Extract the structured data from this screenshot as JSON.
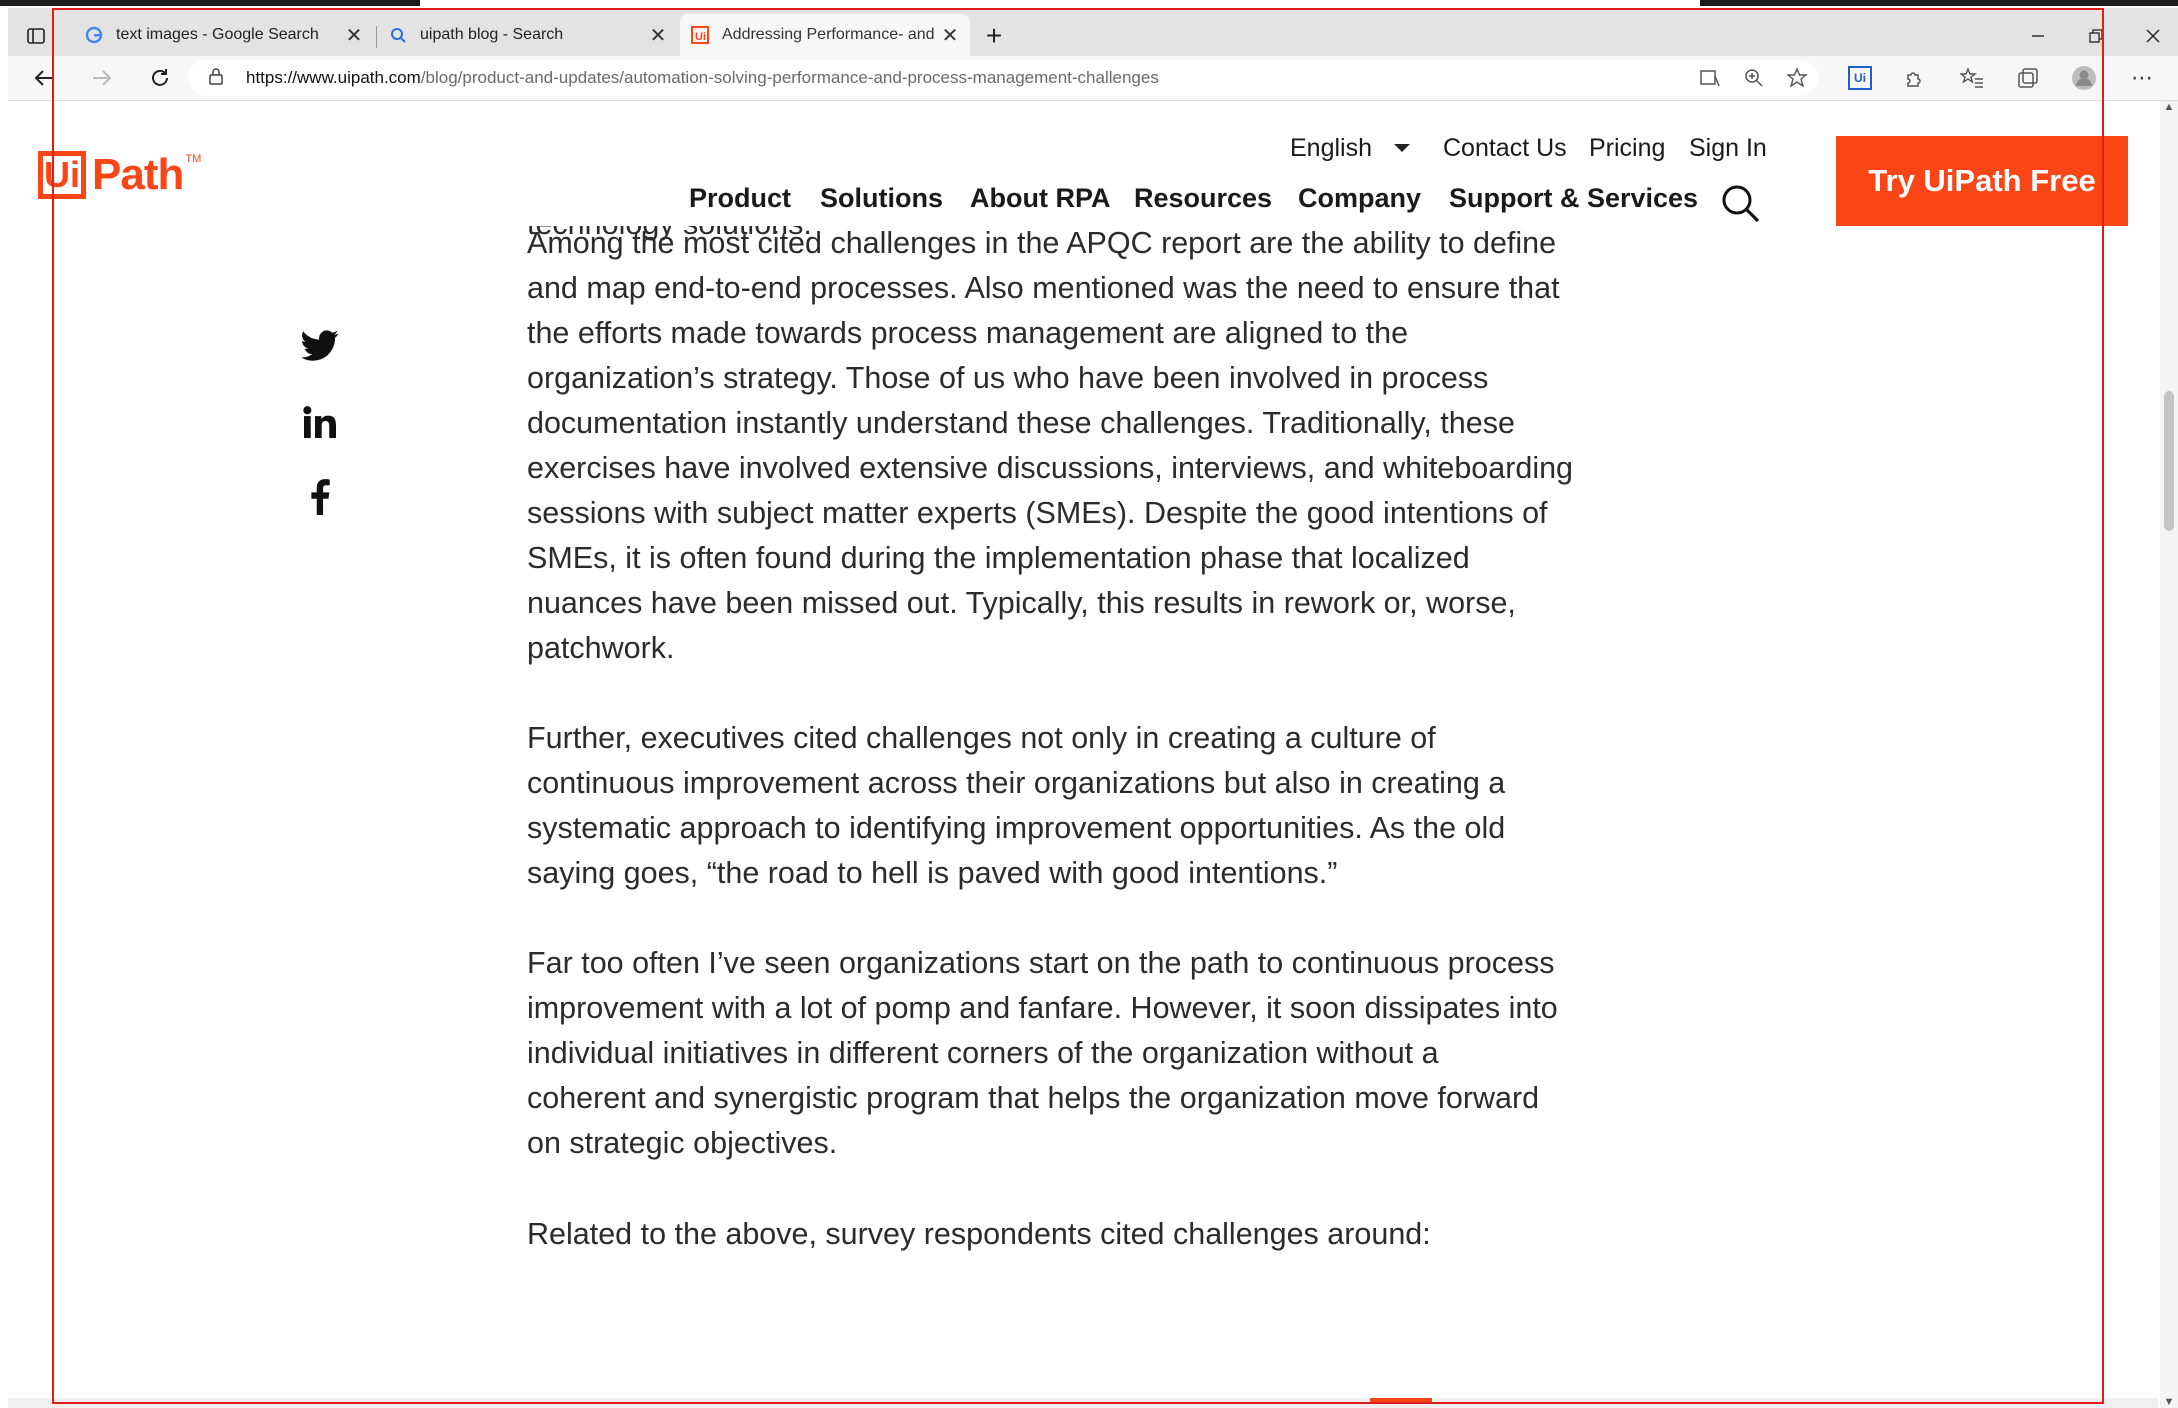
{
  "browser": {
    "tabs": [
      {
        "title": "text images - Google Search",
        "favicon": "google-icon",
        "active": false
      },
      {
        "title": "uipath blog - Search",
        "favicon": "search-icon",
        "active": false
      },
      {
        "title": "Addressing Performance- and Pr",
        "favicon": "uipath-icon",
        "active": true
      }
    ],
    "new_tab": "+",
    "url_host": "https://www.uipath.com",
    "url_path": "/blog/product-and-updates/automation-solving-performance-and-process-management-challenges",
    "extension_badge": "Ui"
  },
  "site": {
    "logo_text": "Path",
    "logo_box": "Ui",
    "logo_tm": "TM",
    "utility_nav": {
      "language": "English",
      "contact": "Contact Us",
      "pricing": "Pricing",
      "signin": "Sign In"
    },
    "main_nav": [
      "Product",
      "Solutions",
      "About RPA",
      "Resources",
      "Company",
      "Support & Services"
    ],
    "cta": "Try UiPath Free",
    "brand_color": "#fa4616"
  },
  "share": [
    "twitter-icon",
    "linkedin-icon",
    "facebook-icon"
  ],
  "article": {
    "clipped_line": "technology solutions.",
    "paragraphs": [
      [
        "Among the most cited challenges in the APQC report are the ability to define",
        "and map end-to-end processes. Also mentioned was the need to ensure that",
        "the efforts made towards process management are aligned to the",
        "organization’s strategy. Those of us who have been involved in process",
        "documentation instantly understand these challenges. Traditionally, these",
        "exercises have involved extensive discussions, interviews, and whiteboarding",
        "sessions with subject matter experts (SMEs). Despite the good intentions of",
        "SMEs, it is often found during the implementation phase that localized",
        "nuances have been missed out. Typically, this results in rework or, worse,",
        "patchwork."
      ],
      [
        "Further, executives cited challenges not only in creating a culture of",
        "continuous improvement across their organizations but also in creating a",
        "systematic approach to identifying improvement opportunities. As the old",
        "saying goes, “the road to hell is paved with good intentions.”"
      ],
      [
        "Far too often I’ve seen organizations start on the path to continuous process",
        "improvement with a lot of pomp and fanfare. However, it soon dissipates into",
        "individual initiatives in different corners of the organization without a",
        "coherent and synergistic program that helps the organization move forward",
        "on strategic objectives."
      ],
      [
        "Related to the above, survey respondents cited challenges around:"
      ]
    ]
  }
}
